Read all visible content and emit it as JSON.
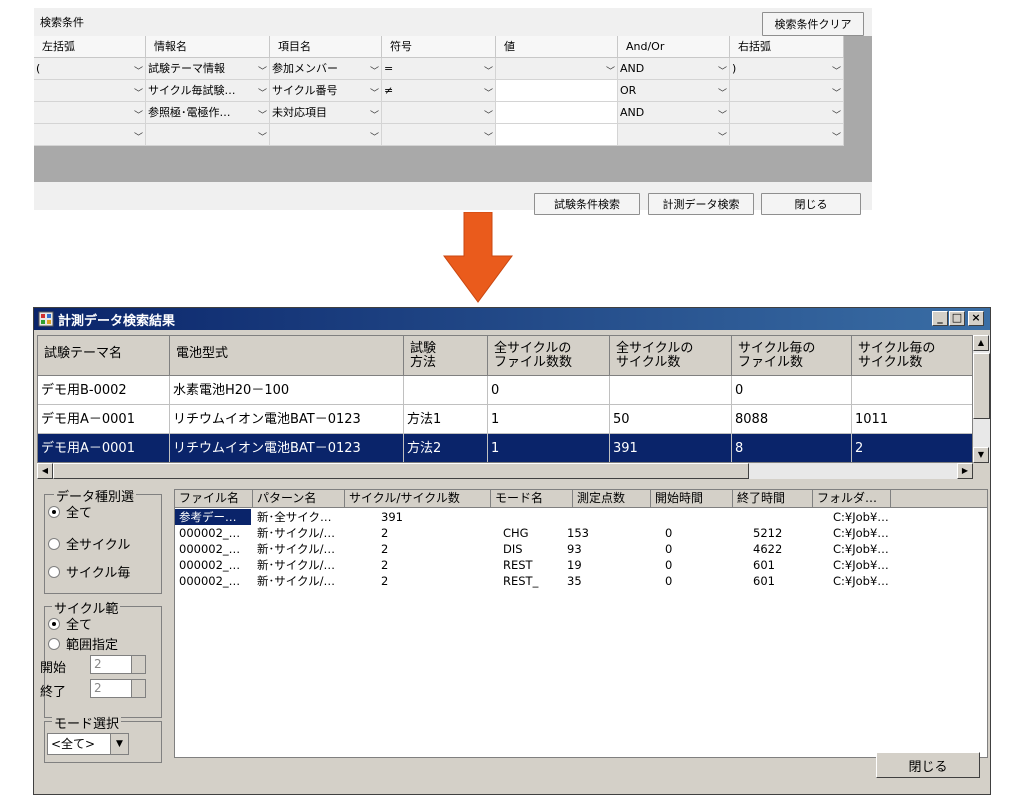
{
  "search_panel": {
    "title": "検索条件",
    "clear_button": "検索条件クリア",
    "columns": [
      "左括弧",
      "情報名",
      "項目名",
      "符号",
      "値",
      "And/Or",
      "右括弧"
    ],
    "rows": [
      [
        "(",
        "試験テーマ情報",
        "参加メンバー",
        "=",
        "",
        "AND",
        ")"
      ],
      [
        "",
        "サイクル毎試験…",
        "サイクル番号",
        "≠",
        "",
        "OR",
        ""
      ],
      [
        "",
        "参照極･電極作…",
        "未対応項目",
        "",
        "",
        "AND",
        ""
      ],
      [
        "",
        "",
        "",
        "",
        "",
        "",
        ""
      ]
    ],
    "search_button": "試験条件検索",
    "measure_button": "計測データ検索",
    "close_button": "閉じる"
  },
  "colors": {
    "arrow": "#ea5b1c",
    "titlebar": "#0a246a",
    "selection": "#0a246a"
  },
  "result_window": {
    "title": "計測データ検索結果",
    "title_buttons": [
      "_",
      "□",
      "×"
    ],
    "columns": [
      "試験テーマ名",
      "電池型式",
      "試験\n方法",
      "全サイクルの\nファイル数数",
      "全サイクルの\nサイクル数",
      "サイクル毎の\nファイル数",
      "サイクル毎の\nサイクル数"
    ],
    "rows": [
      [
        "デモ用B-0002",
        "水素電池H20－100",
        "",
        "0",
        "",
        "0",
        ""
      ],
      [
        "デモ用A－0001",
        "リチウムイオン電池BAT－0123",
        "方法1",
        "1",
        "50",
        "8088",
        "1011"
      ],
      [
        "デモ用A－0001",
        "リチウムイオン電池BAT－0123",
        "方法2",
        "1",
        "391",
        "8",
        "2"
      ]
    ],
    "data_kind_group": {
      "label": "データ種別選",
      "options": [
        "全て",
        "全サイクル",
        "サイクル毎"
      ]
    },
    "cycle_range_group": {
      "label": "サイクル範",
      "options": [
        "全て",
        "範囲指定"
      ],
      "start_label": "開始",
      "start_value": "2",
      "end_label": "終了",
      "end_value": "2"
    },
    "mode_group": {
      "label": "モード選択",
      "selected": "<全て>"
    },
    "file_columns": [
      "ファイル名",
      "パターン名",
      "サイクル/サイクル数",
      "モード名",
      "測定点数",
      "開始時間",
      "終了時間",
      "フォルダ…"
    ],
    "file_rows": [
      [
        "参考デー…",
        "新･全サイク…",
        "391",
        "",
        "",
        "",
        "",
        "C:¥Job¥…"
      ],
      [
        "000002_…",
        "新･サイクル/…",
        "2",
        "CHG",
        "153",
        "0",
        "5212",
        "C:¥Job¥…"
      ],
      [
        "000002_…",
        "新･サイクル/…",
        "2",
        "DIS",
        "93",
        "0",
        "4622",
        "C:¥Job¥…"
      ],
      [
        "000002_…",
        "新･サイクル/…",
        "2",
        "REST",
        "19",
        "0",
        "601",
        "C:¥Job¥…"
      ],
      [
        "000002_…",
        "新･サイクル/…",
        "2",
        "REST_",
        "35",
        "0",
        "601",
        "C:¥Job¥…"
      ]
    ],
    "close_button": "閉じる"
  }
}
